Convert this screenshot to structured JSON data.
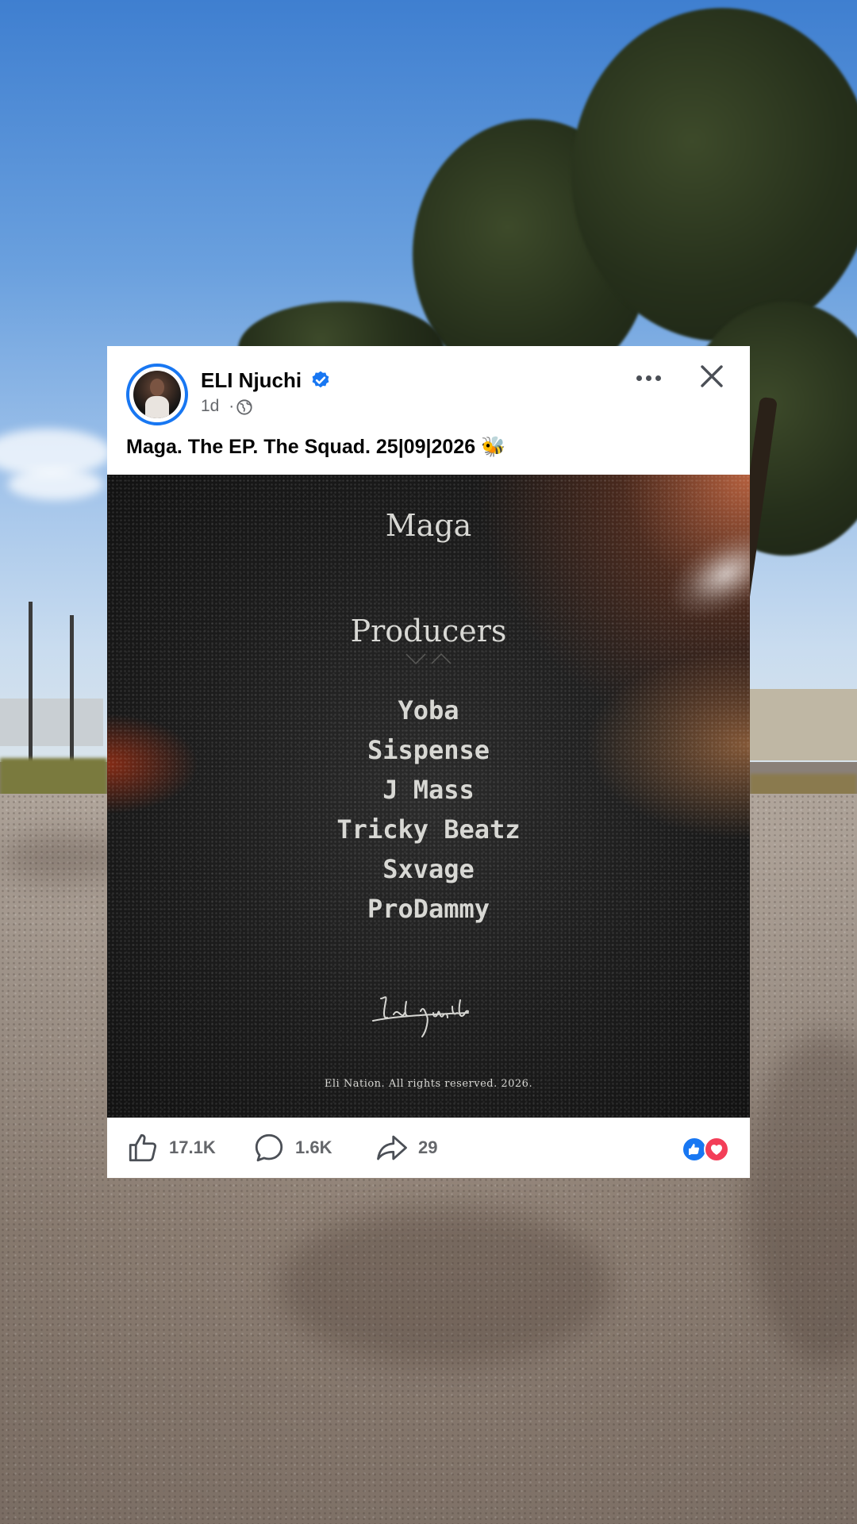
{
  "post": {
    "author": "ELI Njuchi",
    "time": "1d",
    "separator": "·",
    "caption": "Maga.  The EP. The Squad. 25|09|2026",
    "caption_emoji": "🐝"
  },
  "poster": {
    "title": "Maga",
    "subtitle": "Producers",
    "producers": [
      "Yoba",
      "Sispense",
      "J Mass",
      "Tricky Beatz",
      "Sxvage",
      "ProDammy"
    ],
    "signature": "Eli njuchi",
    "copyright": "Eli Nation. All rights reserved. 2026."
  },
  "actions": {
    "likes": "17.1K",
    "comments": "1.6K",
    "shares": "29"
  },
  "icons": {
    "verified": "verified-badge-icon",
    "audience": "globe-icon",
    "more": "more-options-icon",
    "close": "close-icon",
    "like": "thumbs-up-icon",
    "comment": "comment-icon",
    "share": "share-arrow-icon",
    "reaction_like": "like-reaction-icon",
    "reaction_love": "love-reaction-icon"
  },
  "colors": {
    "accent": "#1877f2",
    "love": "#f33e58",
    "text": "#050505",
    "muted": "#65676b"
  }
}
